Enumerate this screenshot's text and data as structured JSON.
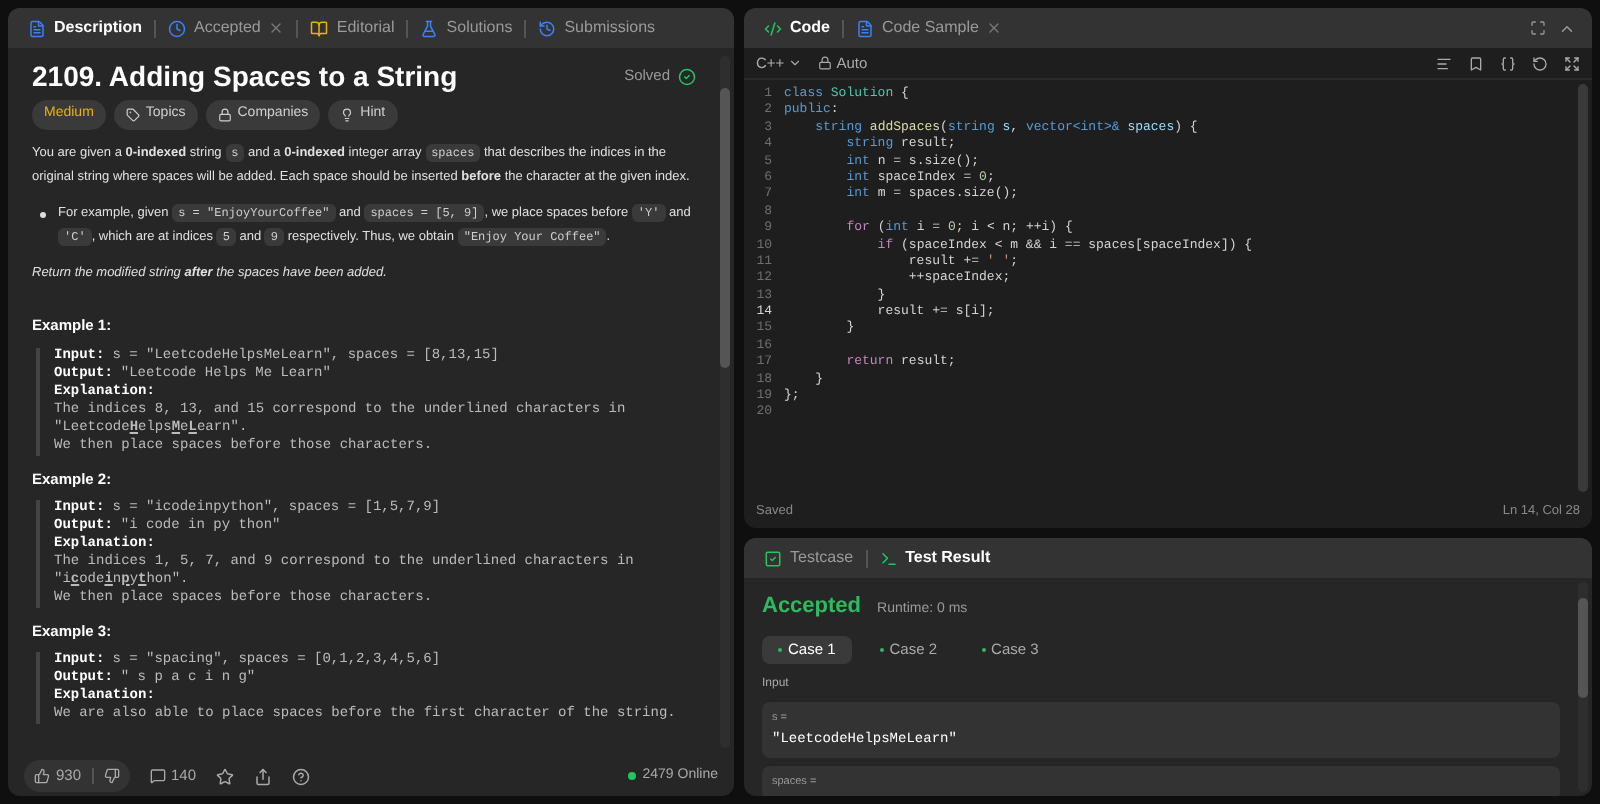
{
  "left_tabs": [
    {
      "label": "Description",
      "selected": true,
      "closable": false,
      "kind": "doc"
    },
    {
      "label": "Accepted",
      "selected": false,
      "closable": true,
      "kind": "clock"
    },
    {
      "label": "Editorial",
      "selected": false,
      "closable": false,
      "kind": "book"
    },
    {
      "label": "Solutions",
      "selected": false,
      "closable": false,
      "kind": "flask"
    },
    {
      "label": "Submissions",
      "selected": false,
      "closable": false,
      "kind": "history"
    }
  ],
  "problem": {
    "title": "2109. Adding Spaces to a String",
    "status": "Solved",
    "difficulty": "Medium",
    "tags": [
      {
        "label": "Topics",
        "kind": "tag"
      },
      {
        "label": "Companies",
        "kind": "lock"
      },
      {
        "label": "Hint",
        "kind": "bulb"
      }
    ],
    "paragraph": [
      {
        "kind": "text",
        "text": "You are given a **0-indexed** string "
      },
      {
        "kind": "code",
        "text": "s"
      },
      {
        "kind": "text",
        "text": " and a **0-indexed** integer array "
      },
      {
        "kind": "code",
        "text": "spaces"
      },
      {
        "kind": "text",
        "text": " that describes the indices in the original string where spaces will be added. Each space should be inserted **before** the character at the given index."
      }
    ],
    "bullet": [
      {
        "kind": "text",
        "text": "For example, given "
      },
      {
        "kind": "code",
        "text": "s = \"EnjoyYourCoffee\""
      },
      {
        "kind": "text",
        "text": " and "
      },
      {
        "kind": "code",
        "text": "spaces = [5, 9]"
      },
      {
        "kind": "text",
        "text": ", we place spaces before "
      },
      {
        "kind": "code",
        "text": "'Y'"
      },
      {
        "kind": "text",
        "text": " and "
      },
      {
        "kind": "code",
        "text": "'C'"
      },
      {
        "kind": "text",
        "text": ", which are at indices "
      },
      {
        "kind": "code",
        "text": "5"
      },
      {
        "kind": "text",
        "text": " and "
      },
      {
        "kind": "code",
        "text": "9"
      },
      {
        "kind": "text",
        "text": " respectively. Thus, we obtain "
      },
      {
        "kind": "code",
        "text": "\"Enjoy Your Coffee\""
      },
      {
        "kind": "text",
        "text": "."
      }
    ],
    "note": "Return the modified string **after** the spaces have been added.",
    "examples": [
      {
        "heading": "Example 1:",
        "input_label": "Input:",
        "input": "s = \"LeetcodeHelpsMeLearn\", spaces = [8,13,15]",
        "output_label": "Output:",
        "output": "\"Leetcode Helps Me Learn\"",
        "explanation_label": "Explanation:",
        "explanation": [
          "The indices 8, 13, and 15 correspond to the underlined characters in",
          "\"Leetcode**H**elps**M**e**L**earn\".",
          "We then place spaces before those characters."
        ]
      },
      {
        "heading": "Example 2:",
        "input_label": "Input:",
        "input": "s = \"icodeinpython\", spaces = [1,5,7,9]",
        "output_label": "Output:",
        "output": "\"i code in py thon\"",
        "explanation_label": "Explanation:",
        "explanation": [
          "The indices 1, 5, 7, and 9 correspond to the underlined characters in",
          "\"i**c**ode**i**n**p**y**t**hon\".",
          "We then place spaces before those characters."
        ]
      },
      {
        "heading": "Example 3:",
        "input_label": "Input:",
        "input": "s = \"spacing\", spaces = [0,1,2,3,4,5,6]",
        "output_label": "Output:",
        "output": "\" s p a c i n g\"",
        "explanation_label": "Explanation:",
        "explanation": [
          "We are also able to place spaces before the first character of the string."
        ]
      }
    ]
  },
  "left_footer": {
    "likes": "930",
    "comments": "140",
    "online": "2479 Online"
  },
  "editor": {
    "tabs": [
      {
        "label": "Code",
        "selected": true,
        "closable": false,
        "kind": "code"
      },
      {
        "label": "Code Sample",
        "selected": false,
        "closable": true,
        "kind": "doc"
      }
    ],
    "language": "C++",
    "mode": "Auto",
    "lines": [
      {
        "number": "1",
        "current": false,
        "tokens": [
          {
            "kind": "keyword",
            "text": "class "
          },
          {
            "kind": "type",
            "text": "Solution"
          },
          {
            "kind": "plain",
            "text": " {"
          }
        ]
      },
      {
        "number": "2",
        "current": false,
        "tokens": [
          {
            "kind": "keyword",
            "text": "public"
          },
          {
            "kind": "plain",
            "text": ":"
          }
        ]
      },
      {
        "number": "3",
        "current": false,
        "tokens": [
          {
            "kind": "keyword",
            "text": "    string "
          },
          {
            "kind": "func",
            "text": "addSpaces"
          },
          {
            "kind": "plain",
            "text": "("
          },
          {
            "kind": "keyword",
            "text": "string "
          },
          {
            "kind": "var",
            "text": "s"
          },
          {
            "kind": "plain",
            "text": ", "
          },
          {
            "kind": "keyword",
            "text": "vector<int>& "
          },
          {
            "kind": "var",
            "text": "spaces"
          },
          {
            "kind": "plain",
            "text": ") {"
          }
        ]
      },
      {
        "number": "4",
        "current": false,
        "tokens": [
          {
            "kind": "keyword",
            "text": "        string "
          },
          {
            "kind": "plain",
            "text": "result;"
          }
        ]
      },
      {
        "number": "5",
        "current": false,
        "tokens": [
          {
            "kind": "keyword",
            "text": "        int "
          },
          {
            "kind": "plain",
            "text": "n = s.size();"
          }
        ]
      },
      {
        "number": "6",
        "current": false,
        "tokens": [
          {
            "kind": "keyword",
            "text": "        int "
          },
          {
            "kind": "plain",
            "text": "spaceIndex = "
          },
          {
            "kind": "number",
            "text": "0"
          },
          {
            "kind": "plain",
            "text": ";"
          }
        ]
      },
      {
        "number": "7",
        "current": false,
        "tokens": [
          {
            "kind": "keyword",
            "text": "        int "
          },
          {
            "kind": "plain",
            "text": "m = spaces.size();"
          }
        ]
      },
      {
        "number": "8",
        "current": false
      },
      {
        "number": "9",
        "current": false,
        "tokens": [
          {
            "kind": "control",
            "text": "        for "
          },
          {
            "kind": "plain",
            "text": "("
          },
          {
            "kind": "keyword",
            "text": "int "
          },
          {
            "kind": "plain",
            "text": "i = "
          },
          {
            "kind": "number",
            "text": "0"
          },
          {
            "kind": "plain",
            "text": "; i < n; ++i) {"
          }
        ]
      },
      {
        "number": "10",
        "current": false,
        "tokens": [
          {
            "kind": "control",
            "text": "            if "
          },
          {
            "kind": "plain",
            "text": "(spaceIndex < m && i == spaces[spaceIndex]) {"
          }
        ]
      },
      {
        "number": "11",
        "current": false,
        "tokens": [
          {
            "kind": "plain",
            "text": "                result += "
          },
          {
            "kind": "string",
            "text": "' '"
          },
          {
            "kind": "plain",
            "text": ";"
          }
        ]
      },
      {
        "number": "12",
        "current": false,
        "tokens": [
          {
            "kind": "plain",
            "text": "                ++spaceIndex;"
          }
        ]
      },
      {
        "number": "13",
        "current": false,
        "tokens": [
          {
            "kind": "plain",
            "text": "            }"
          }
        ]
      },
      {
        "number": "14",
        "current": true,
        "tokens": [
          {
            "kind": "plain",
            "text": "            result += s[i];"
          }
        ]
      },
      {
        "number": "15",
        "current": false,
        "tokens": [
          {
            "kind": "plain",
            "text": "        }"
          }
        ]
      },
      {
        "number": "16",
        "current": false
      },
      {
        "number": "17",
        "current": false,
        "tokens": [
          {
            "kind": "control",
            "text": "        return "
          },
          {
            "kind": "plain",
            "text": "result;"
          }
        ]
      },
      {
        "number": "18",
        "current": false,
        "tokens": [
          {
            "kind": "plain",
            "text": "    }"
          }
        ]
      },
      {
        "number": "19",
        "current": false,
        "tokens": [
          {
            "kind": "plain",
            "text": "};"
          }
        ]
      },
      {
        "number": "20",
        "current": false
      }
    ],
    "saved": "Saved",
    "cursor": "Ln 14, Col 28"
  },
  "result": {
    "tabs": [
      {
        "label": "Testcase",
        "selected": false,
        "kind": "check"
      },
      {
        "label": "Test Result",
        "selected": true,
        "kind": "terminal"
      }
    ],
    "verdict": "Accepted",
    "runtime": "Runtime: 0 ms",
    "cases": [
      {
        "label": "Case 1",
        "selected": true
      },
      {
        "label": "Case 2",
        "selected": false
      },
      {
        "label": "Case 3",
        "selected": false
      }
    ],
    "input_label": "Input",
    "params": [
      {
        "name": "s =",
        "value": "\"LeetcodeHelpsMeLearn\""
      },
      {
        "name": "spaces ="
      }
    ]
  }
}
